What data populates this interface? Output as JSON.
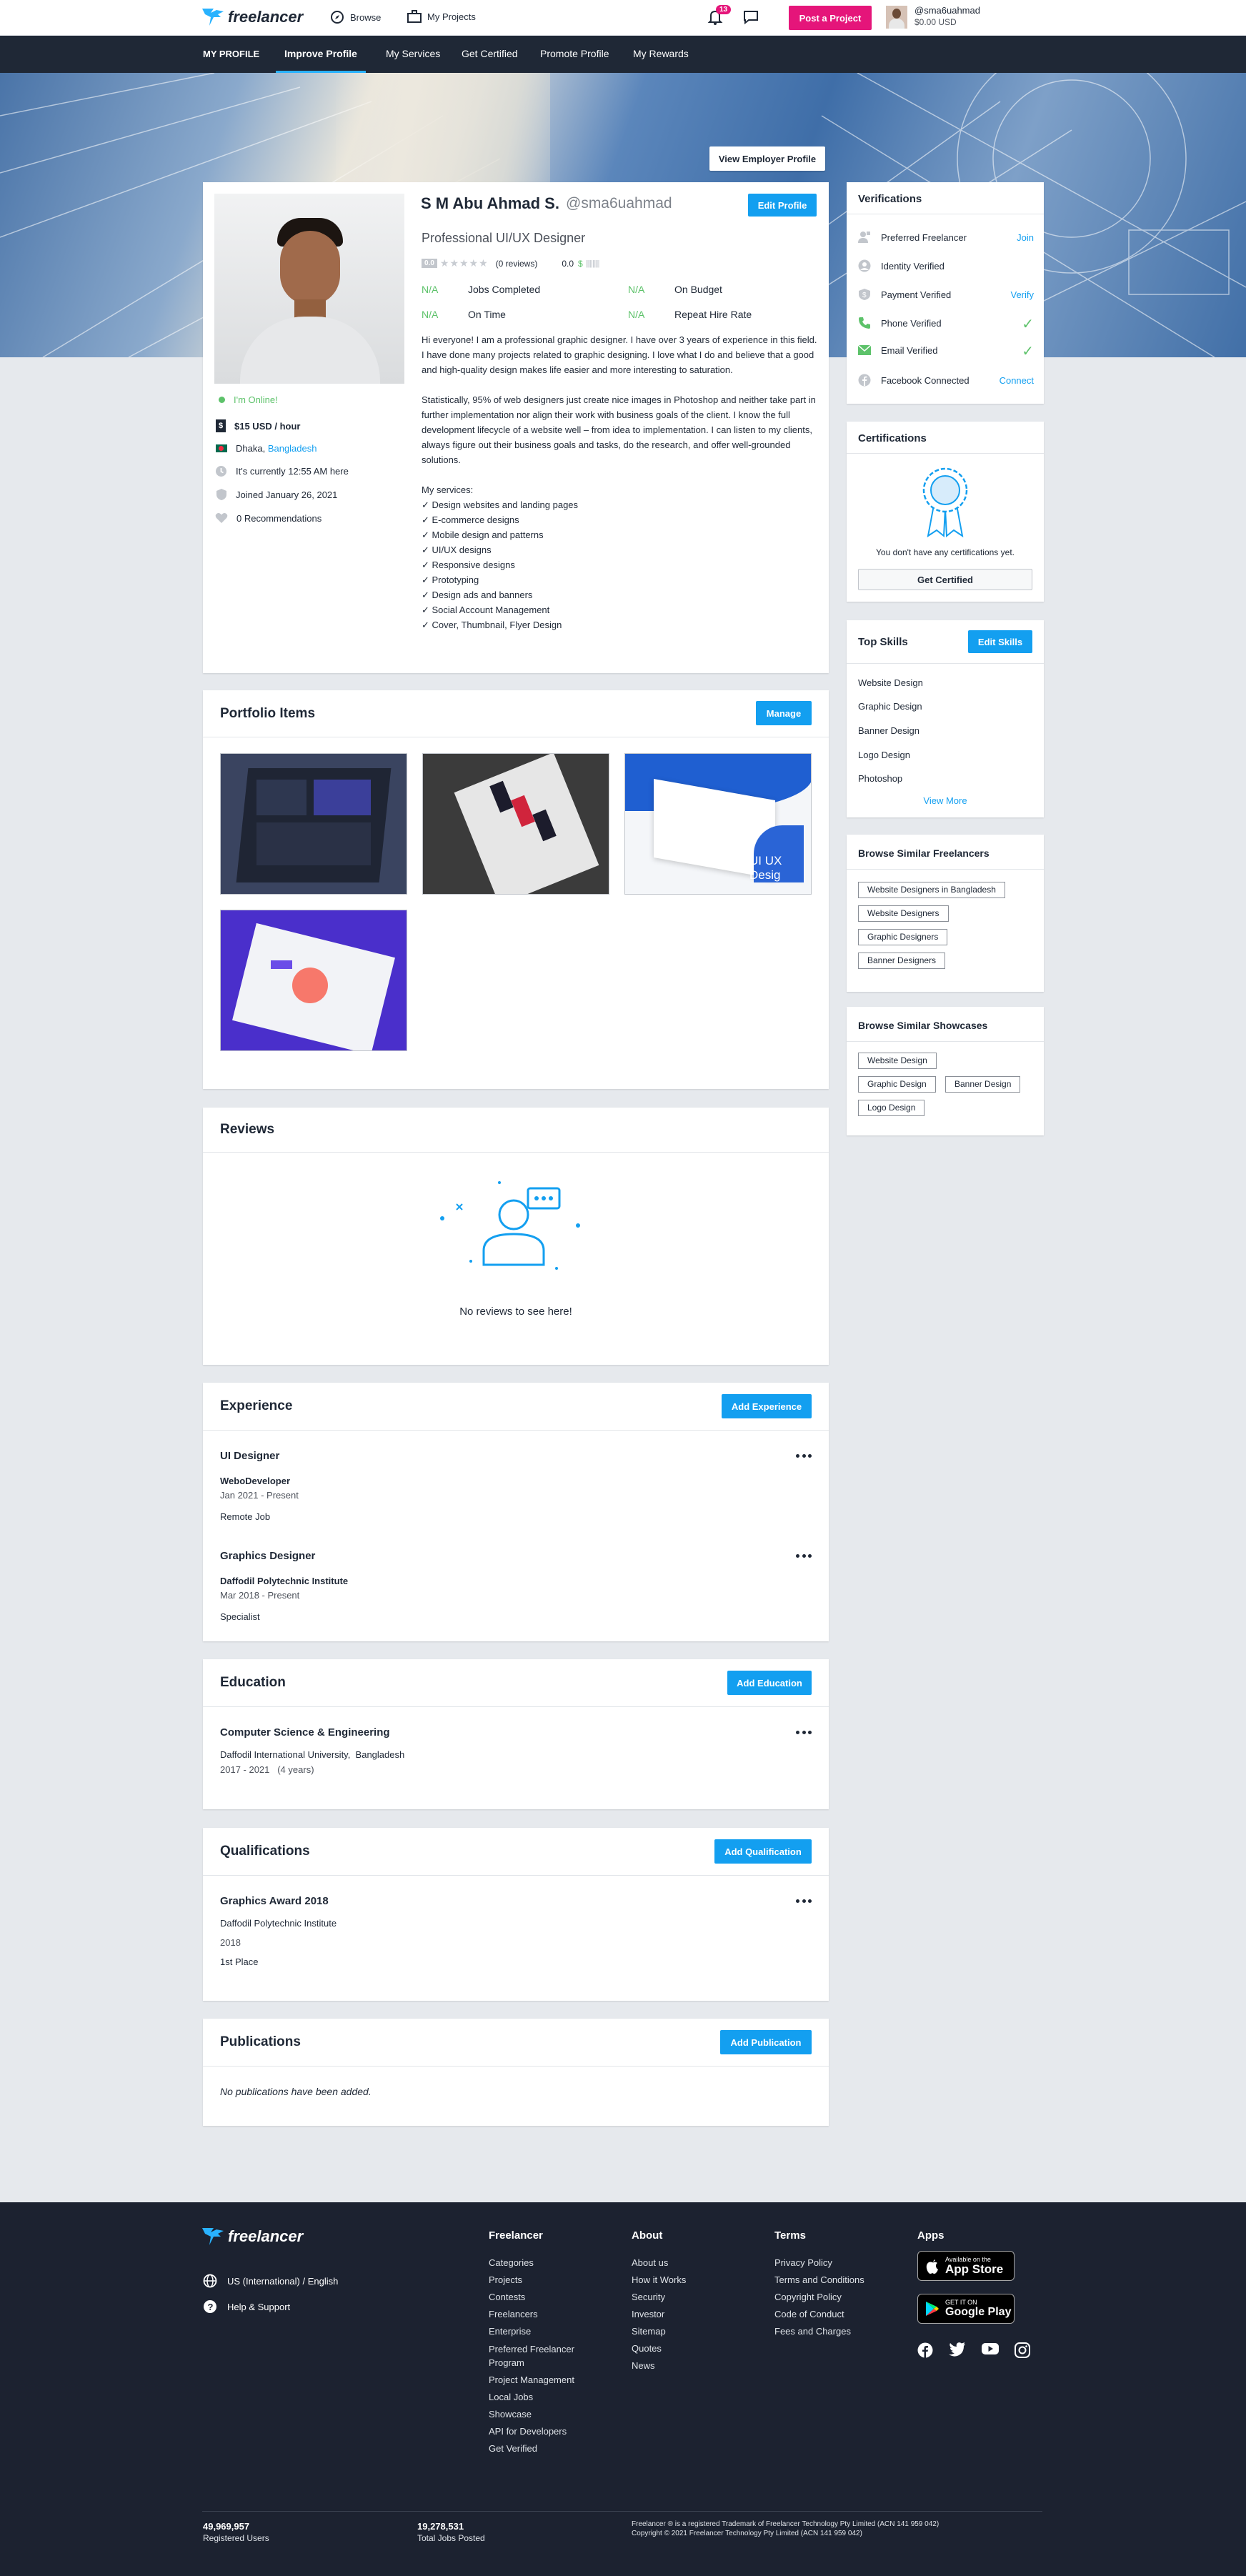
{
  "nav": {
    "logo": "freelancer",
    "browse": "Browse",
    "my_projects": "My Projects",
    "notif_count": "13",
    "post_project": "Post a Project",
    "username": "@sma6uahmad",
    "balance": "$0.00 USD"
  },
  "subnav": {
    "my_profile": "MY PROFILE",
    "items": [
      "Improve Profile",
      "My Services",
      "Get Certified",
      "Promote Profile",
      "My Rewards"
    ]
  },
  "hero": {
    "view_employer": "View Employer Profile"
  },
  "profile": {
    "name": "S M Abu Ahmad S.",
    "handle": "@sma6uahmad",
    "edit": "Edit Profile",
    "headline": "Professional UI/UX Designer",
    "rating": "0.0",
    "reviews": "(0 reviews)",
    "earnings": "0.0",
    "stats": [
      {
        "value": "N/A",
        "label": "Jobs Completed"
      },
      {
        "value": "N/A",
        "label": "On Budget"
      },
      {
        "value": "N/A",
        "label": "On Time"
      },
      {
        "value": "N/A",
        "label": "Repeat Hire Rate"
      }
    ],
    "online": "I'm Online!",
    "rate": "$15 USD / hour",
    "location_city": "Dhaka, ",
    "location_country": "Bangladesh",
    "time": "It's currently 12:55 AM here",
    "joined": "Joined January 26, 2021",
    "recommendations": "0 Recommendations",
    "bio_p1": "Hi everyone! I am a professional graphic designer. I have over 3 years of experience in this field. I have done many projects related to graphic designing. I love what I do and believe that a good and high-quality design makes life easier and more interesting to saturation.",
    "bio_p2": "Statistically, 95% of web designers just create nice images in Photoshop and neither take part in further implementation nor align their work with business goals of the client. I know the full development lifecycle of a website well – from idea to implementation. I can listen to my clients, always figure out their business goals and tasks, do the research, and offer well-grounded solutions.",
    "services_title": "My services:",
    "services": [
      "✓ Design websites and landing pages",
      "✓ E-commerce designs",
      "✓ Mobile design and patterns",
      "✓ UI/UX designs",
      "✓ Responsive designs",
      "✓ Prototyping",
      "✓ Design ads and banners",
      "✓ Social Account Management",
      "✓ Cover, Thumbnail, Flyer Design"
    ]
  },
  "portfolio": {
    "title": "Portfolio Items",
    "manage": "Manage",
    "thumb3_caption": "UI UX Desig"
  },
  "reviews": {
    "title": "Reviews",
    "empty": "No reviews to see here!"
  },
  "experience": {
    "title": "Experience",
    "add": "Add Experience",
    "items": [
      {
        "title": "UI Designer",
        "company": "WeboDeveloper",
        "dates": "Jan 2021 - Present",
        "desc": "Remote Job"
      },
      {
        "title": "Graphics Designer",
        "company": "Daffodil Polytechnic Institute",
        "dates": "Mar 2018 - Present",
        "desc": "Specialist"
      }
    ]
  },
  "education": {
    "title": "Education",
    "add": "Add Education",
    "degree": "Computer Science & Engineering",
    "school": "Daffodil International University,  Bangladesh",
    "years": "2017 - 2021   (4 years)"
  },
  "qualifications": {
    "title": "Qualifications",
    "add": "Add Qualification",
    "name": "Graphics Award 2018",
    "org": "Daffodil Polytechnic Institute",
    "year": "2018",
    "desc": "1st Place"
  },
  "publications": {
    "title": "Publications",
    "add": "Add Publication",
    "empty": "No publications have been added."
  },
  "verifications": {
    "title": "Verifications",
    "items": [
      {
        "label": "Preferred Freelancer",
        "action": "Join"
      },
      {
        "label": "Identity Verified",
        "action": ""
      },
      {
        "label": "Payment Verified",
        "action": "Verify"
      },
      {
        "label": "Phone Verified",
        "action": "✓"
      },
      {
        "label": "Email Verified",
        "action": "✓"
      },
      {
        "label": "Facebook Connected",
        "action": "Connect"
      }
    ]
  },
  "certifications": {
    "title": "Certifications",
    "empty": "You don't have any certifications yet.",
    "cta": "Get Certified"
  },
  "top_skills": {
    "title": "Top Skills",
    "edit": "Edit Skills",
    "items": [
      "Website Design",
      "Graphic Design",
      "Banner Design",
      "Logo Design",
      "Photoshop"
    ],
    "more": "View More"
  },
  "similar_freelancers": {
    "title": "Browse Similar Freelancers",
    "items": [
      "Website Designers in Bangladesh",
      "Website Designers",
      "Graphic Designers",
      "Banner Designers"
    ]
  },
  "similar_showcases": {
    "title": "Browse Similar Showcases",
    "items": [
      "Website Design",
      "Graphic Design",
      "Banner Design",
      "Logo Design"
    ]
  },
  "footer": {
    "logo": "freelancer",
    "locale": "US (International) / English",
    "help": "Help & Support",
    "cols": [
      {
        "title": "Freelancer",
        "links": [
          "Categories",
          "Projects",
          "Contests",
          "Freelancers",
          "Enterprise",
          "Preferred Freelancer Program",
          "Project Management",
          "Local Jobs",
          "Showcase",
          "API for Developers",
          "Get Verified"
        ]
      },
      {
        "title": "About",
        "links": [
          "About us",
          "How it Works",
          "Security",
          "Investor",
          "Sitemap",
          "Quotes",
          "News"
        ]
      },
      {
        "title": "Terms",
        "links": [
          "Privacy Policy",
          "Terms and Conditions",
          "Copyright Policy",
          "Code of Conduct",
          "Fees and Charges"
        ]
      }
    ],
    "apps_title": "Apps",
    "appstore_small": "Available on the",
    "appstore": "App Store",
    "googleplay_small": "GET IT ON",
    "googleplay": "Google Play",
    "registered_users": "49,969,957",
    "registered_users_label": "Registered Users",
    "jobs_posted": "19,278,531",
    "jobs_posted_label": "Total Jobs Posted",
    "legal1": "Freelancer ® is a registered Trademark of Freelancer Technology Pty Limited (ACN 141 959 042)",
    "legal2": "Copyright © 2021 Freelancer Technology Pty Limited (ACN 141 959 042)"
  },
  "colors": {
    "accent": "#139ff0",
    "brand_pink": "#e5157a",
    "green": "#5dc26a",
    "nav_dark": "#1f2836",
    "footer_bg": "#1c2230"
  }
}
